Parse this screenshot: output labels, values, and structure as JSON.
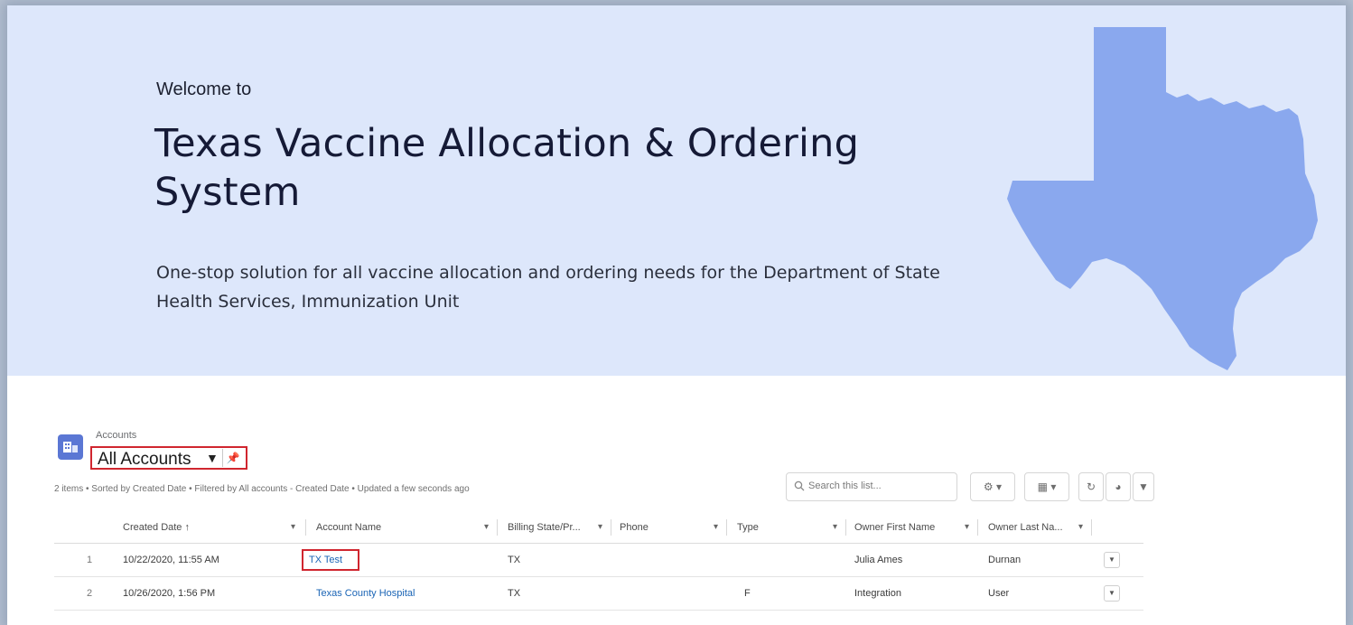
{
  "hero": {
    "welcome": "Welcome to",
    "title": "Texas Vaccine Allocation & Ordering System",
    "subtitle": "One-stop solution for all vaccine allocation and ordering needs for the Department of State Health Services, Immunization Unit"
  },
  "list": {
    "object_label": "Accounts",
    "view_name": "All Accounts",
    "meta": "2 items • Sorted by Created Date • Filtered by All accounts - Created Date • Updated a few seconds ago",
    "search_placeholder": "Search this list...",
    "columns": [
      "Created Date ↑",
      "Account Name",
      "Billing State/Pr...",
      "Phone",
      "Type",
      "Owner First Name",
      "Owner Last Na..."
    ],
    "rows": [
      {
        "num": "1",
        "created": "10/22/2020, 11:55 AM",
        "name": "TX Test",
        "state": "TX",
        "phone": "",
        "type": "",
        "first": "Julia Ames",
        "last": "Durnan"
      },
      {
        "num": "2",
        "created": "10/26/2020, 1:56 PM",
        "name": "Texas County Hospital",
        "state": "TX",
        "phone": "",
        "type": "F",
        "first": "Integration",
        "last": "User"
      }
    ]
  },
  "colors": {
    "hero_bg": "#dde7fb",
    "texas": "#8aa8ee",
    "highlight": "#d0262f",
    "link": "#1a64b5"
  }
}
